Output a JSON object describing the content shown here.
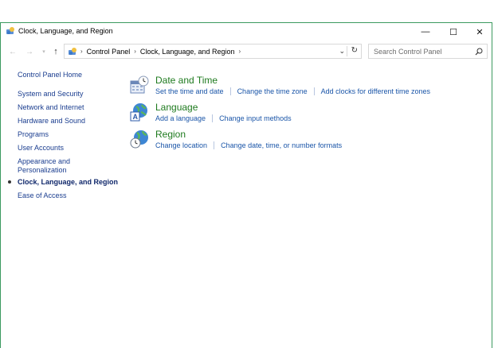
{
  "window": {
    "title": "Clock, Language, and Region",
    "controls": {
      "minimize": "—",
      "maximize": "☐",
      "close": "✕"
    }
  },
  "address": {
    "crumbs": [
      "Control Panel",
      "Clock, Language, and Region"
    ],
    "separator": "›"
  },
  "search": {
    "placeholder": "Search Control Panel"
  },
  "sidebar": {
    "items": [
      {
        "label": "Control Panel Home"
      },
      {
        "label": "System and Security"
      },
      {
        "label": "Network and Internet"
      },
      {
        "label": "Hardware and Sound"
      },
      {
        "label": "Programs"
      },
      {
        "label": "User Accounts"
      },
      {
        "label": "Appearance and"
      },
      {
        "label": "Personalization"
      },
      {
        "label": "Clock, Language, and Region"
      },
      {
        "label": "Ease of Access"
      }
    ]
  },
  "categories": [
    {
      "title": "Date and Time",
      "links": [
        "Set the time and date",
        "Change the time zone",
        "Add clocks for different time zones"
      ]
    },
    {
      "title": "Language",
      "links": [
        "Add a language",
        "Change input methods"
      ]
    },
    {
      "title": "Region",
      "links": [
        "Change location",
        "Change date, time, or number formats"
      ]
    }
  ],
  "colors": {
    "border": "#3c9a5f",
    "category_title": "#1e7a1e",
    "link": "#1a55a8",
    "sidebar_link": "#1a3d8f"
  }
}
